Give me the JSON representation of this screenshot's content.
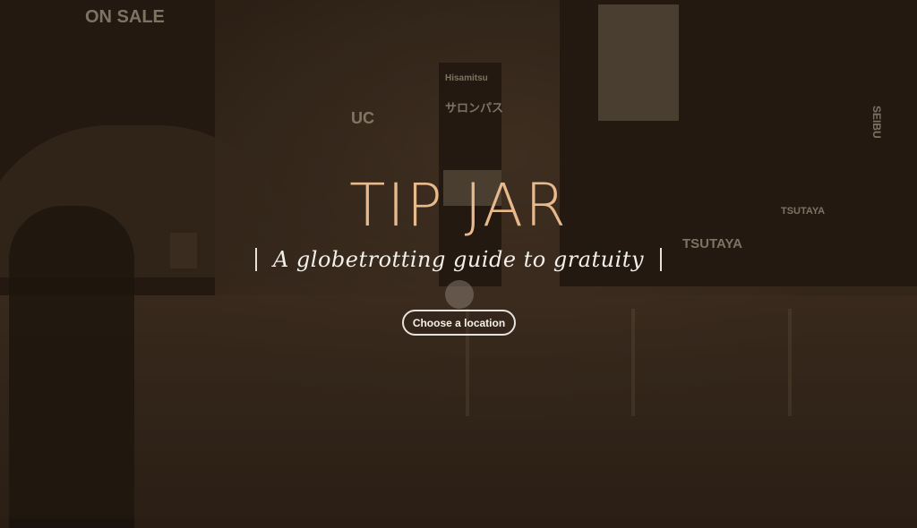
{
  "hero": {
    "title": "TIP JAR",
    "subtitle": "A globetrotting guide to gratuity",
    "cta_label": "Choose a location"
  },
  "background_signs": {
    "on_sale": "ON SALE",
    "tsutaya": "TSUTAYA",
    "tsutaya_small": "TSUTAYA",
    "uc": "UC",
    "salonpas": "サロンパス",
    "hisamitsu": "Hisamitsu",
    "seibu": "SEIBU"
  },
  "colors": {
    "title": "#e7b98d",
    "overlay": "#2a1d14",
    "button_border": "#e7e2db"
  },
  "icons": {
    "globe": "globe-icon"
  }
}
